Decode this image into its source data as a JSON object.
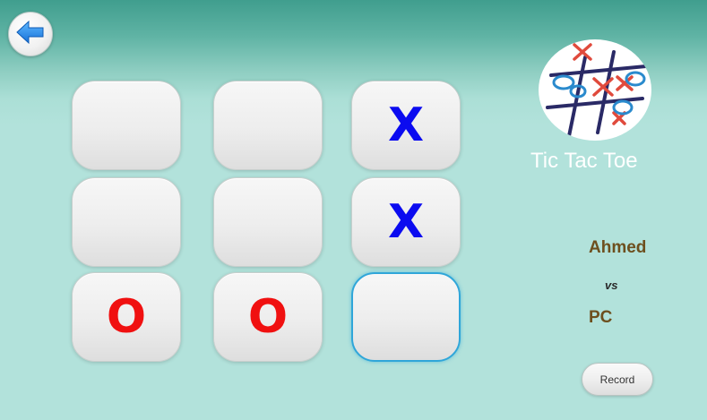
{
  "header": {
    "back_icon": "arrow-left-icon"
  },
  "board": {
    "cells": [
      {
        "mark": "",
        "color": ""
      },
      {
        "mark": "",
        "color": ""
      },
      {
        "mark": "X",
        "color": "#0b0bf0"
      },
      {
        "mark": "",
        "color": ""
      },
      {
        "mark": "",
        "color": ""
      },
      {
        "mark": "X",
        "color": "#0b0bf0"
      },
      {
        "mark": "O",
        "color": "#f01010"
      },
      {
        "mark": "O",
        "color": "#f01010"
      },
      {
        "mark": "",
        "color": ""
      }
    ]
  },
  "side_panel": {
    "logo_icon": "tic-tac-toe-logo",
    "title": "Tic Tac Toe",
    "player1": "Ahmed",
    "vs": "vs",
    "player2": "PC",
    "record_label": "Record"
  },
  "colors": {
    "x_mark": "#0b0bf0",
    "o_mark": "#f01010",
    "background": "#b2e2db",
    "header": "#409e8e",
    "player_name": "#6d4f1e"
  }
}
